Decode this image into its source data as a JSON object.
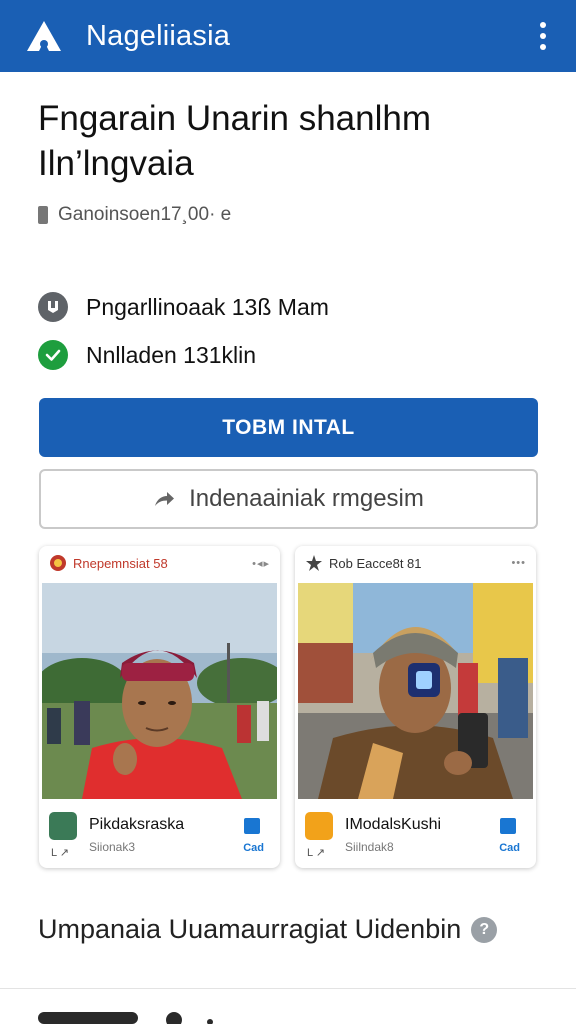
{
  "appbar": {
    "title": "Nageliiasia",
    "logo_icon": "app-logo-icon",
    "menu_icon": "more-vert-icon",
    "color": "#1a5fb4"
  },
  "article": {
    "headline": "Fngarain Unarin  shanlhm Iln’lngvaia",
    "meta": "Ganoinsoen17¸00· е"
  },
  "stats": [
    {
      "icon": "user-circle-icon",
      "text": "Pngarllinoaak 13ß Mam"
    },
    {
      "icon": "check-circle-icon",
      "text": "Nnlladen 131klin"
    }
  ],
  "buttons": {
    "primary": "TOBM INTAL",
    "secondary": "Indenaainiak rmgesim"
  },
  "cards": [
    {
      "header": "Rnepemnsiat 58",
      "header_dots": "•◂▸",
      "user": "Pikdaksraska",
      "handle": "Siionak3",
      "small": "L ↗",
      "action": "Cad"
    },
    {
      "header": "Rob Eacce8t 81",
      "header_dots": "•••",
      "user": "IModalsKushi",
      "handle": "Siilndak8",
      "small": "L ↗",
      "action": "Cad"
    }
  ],
  "section": {
    "title": "Umpanaia Uuamaurragiat Uidenbin",
    "help": "?"
  }
}
